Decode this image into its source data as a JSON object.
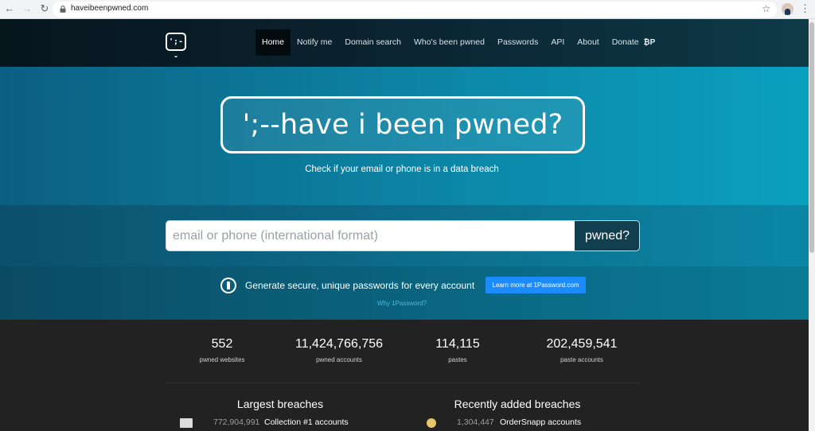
{
  "browser": {
    "url": "haveibeenpwned.com",
    "back_glyph": "←",
    "forward_glyph": "→",
    "reload_glyph": "↻",
    "star_glyph": "☆",
    "menu_glyph": "⋮"
  },
  "navbar": {
    "logo_text": "';--",
    "items": [
      {
        "label": "Home",
        "active": true
      },
      {
        "label": "Notify me"
      },
      {
        "label": "Domain search"
      },
      {
        "label": "Who's been pwned"
      },
      {
        "label": "Passwords"
      },
      {
        "label": "API"
      },
      {
        "label": "About"
      },
      {
        "label": "Donate"
      }
    ],
    "donate_icons": [
      "bitcoin-icon",
      "paypal-icon"
    ]
  },
  "hero": {
    "title": "';--have i been pwned?",
    "tagline": "Check if your email or phone is in a data breach"
  },
  "search": {
    "placeholder": "email or phone (international format)",
    "value": "",
    "button_label": "pwned?"
  },
  "promo": {
    "text": "Generate secure, unique passwords for every account",
    "button_label": "Learn more at 1Password.com",
    "link_text": "Why 1Password?"
  },
  "stats": [
    {
      "value": "552",
      "label": "pwned websites"
    },
    {
      "value": "11,424,766,756",
      "label": "pwned accounts"
    },
    {
      "value": "114,115",
      "label": "pastes"
    },
    {
      "value": "202,459,541",
      "label": "paste accounts"
    }
  ],
  "largest_breaches": {
    "title": "Largest breaches",
    "items": [
      {
        "count": "772,904,991",
        "name": "Collection #1 accounts"
      }
    ]
  },
  "recent_breaches": {
    "title": "Recently added breaches",
    "items": [
      {
        "count": "1,304,447",
        "name": "OrderSnapp accounts"
      }
    ]
  },
  "colors": {
    "nav_bg": "#0b2633",
    "hero_bg": "#0d86a6",
    "search_button_bg": "#123f50",
    "promo_button_bg": "#1a8cff",
    "stats_bg": "#222222"
  }
}
